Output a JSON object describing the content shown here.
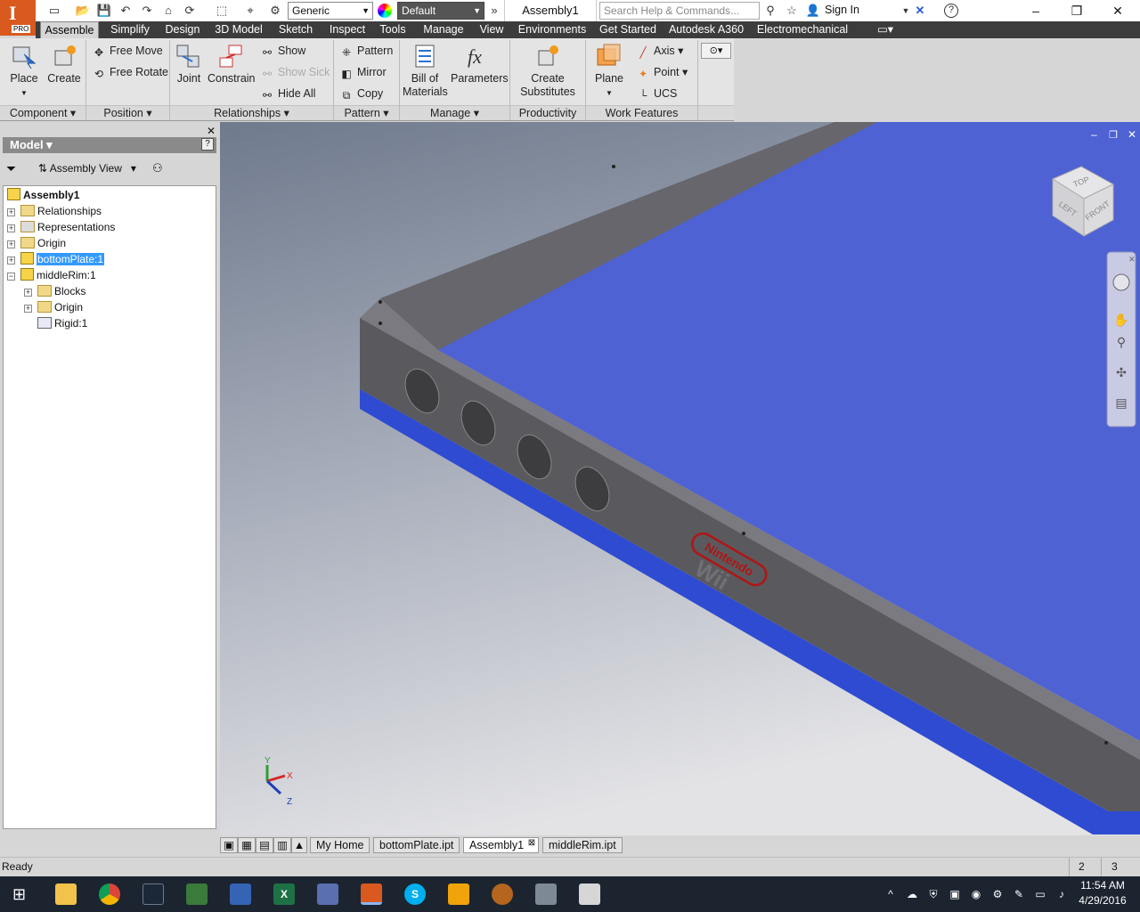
{
  "app": {
    "logo_text": "I",
    "edition": "PRO"
  },
  "title_bar": {
    "material_combo": "Generic",
    "appearance_combo": "Default",
    "document_title": "Assembly1",
    "search_placeholder": "Search Help & Commands...",
    "sign_in": "Sign In"
  },
  "menu_tabs": [
    "Assemble",
    "Simplify",
    "Design",
    "3D Model",
    "Sketch",
    "Inspect",
    "Tools",
    "Manage",
    "View",
    "Environments",
    "Get Started",
    "Autodesk A360",
    "Electromechanical"
  ],
  "ribbon": {
    "component": {
      "label": "Component",
      "place": "Place",
      "create": "Create"
    },
    "position": {
      "label": "Position",
      "free_move": "Free Move",
      "free_rotate": "Free Rotate"
    },
    "relationships": {
      "label": "Relationships",
      "joint": "Joint",
      "constrain": "Constrain",
      "show": "Show",
      "show_sick": "Show Sick",
      "hide_all": "Hide All"
    },
    "pattern": {
      "label": "Pattern",
      "pattern": "Pattern",
      "mirror": "Mirror",
      "copy": "Copy"
    },
    "manage": {
      "label": "Manage",
      "bom_line1": "Bill of",
      "bom_line2": "Materials",
      "parameters": "Parameters"
    },
    "productivity": {
      "label": "Productivity",
      "substitutes_line1": "Create",
      "substitutes_line2": "Substitutes"
    },
    "work_features": {
      "label": "Work Features",
      "plane": "Plane",
      "axis": "Axis",
      "point": "Point",
      "ucs": "UCS"
    }
  },
  "browser": {
    "title": "Model",
    "view": "Assembly View",
    "tree": [
      {
        "label": "Assembly1"
      },
      {
        "label": "Relationships"
      },
      {
        "label": "Representations"
      },
      {
        "label": "Origin"
      },
      {
        "label": "bottomPlate:1"
      },
      {
        "label": "middleRim:1"
      },
      {
        "label": "Blocks"
      },
      {
        "label": "Origin"
      },
      {
        "label": "Rigid:1"
      }
    ]
  },
  "viewport": {
    "viewcube_top": "TOP",
    "viewcube_left": "LEFT",
    "viewcube_front": "FRONT",
    "logo_text": "Nintendo",
    "logo_sub": "Wii",
    "axis_x": "X",
    "axis_y": "Y",
    "axis_z": "Z",
    "plate_color": "#4f62d4",
    "rim_color": "#5a5a5e"
  },
  "doc_tabs": [
    "My Home",
    "bottomPlate.ipt",
    "Assembly1",
    "middleRim.ipt"
  ],
  "status": {
    "text": "Ready",
    "count1": "2",
    "count2": "3"
  },
  "clock": {
    "time": "11:54 AM",
    "date": "4/29/2016"
  }
}
